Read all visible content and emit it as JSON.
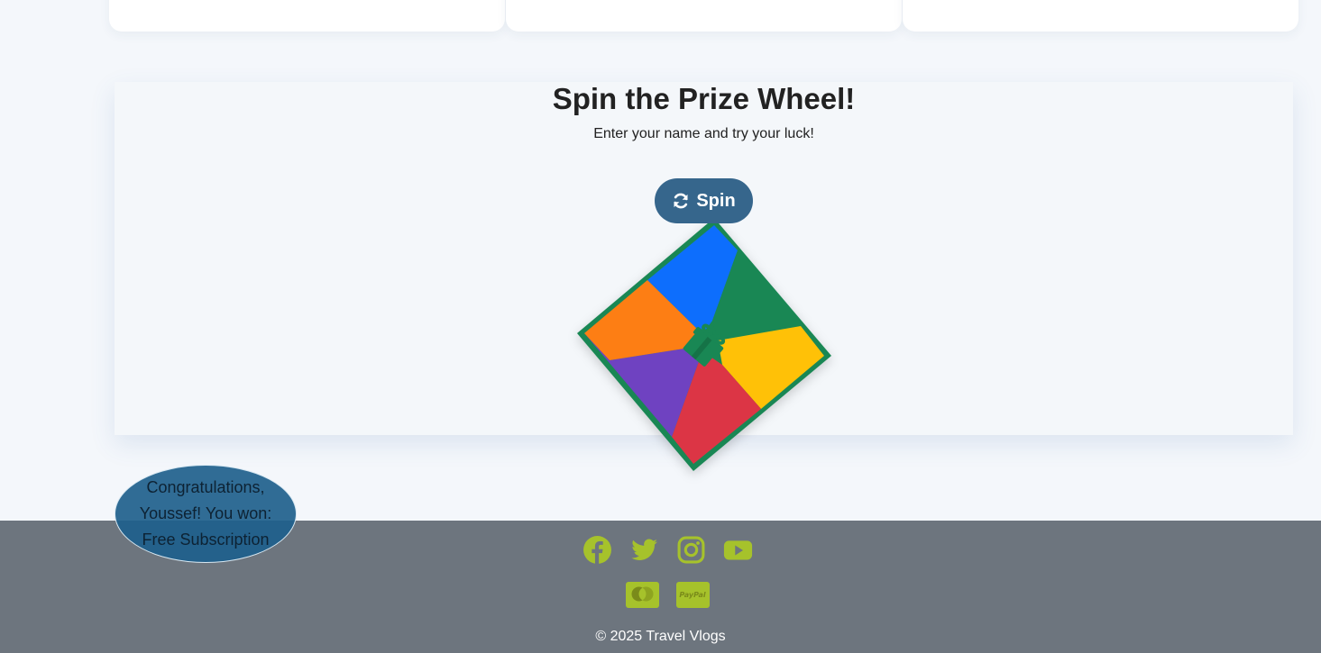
{
  "wheel": {
    "title": "Spin the Prize Wheel!",
    "subtitle": "Enter your name and try your luck!",
    "spin_label": "Spin",
    "segment_colors": [
      "#0d6efd",
      "#198754",
      "#ffc107",
      "#dc3545",
      "#6f42c1",
      "#fd7e14"
    ],
    "border_color": "#198754",
    "center_icon": "gift-icon"
  },
  "result": {
    "message": "Congratulations, Youssef! You won: Free Subscription"
  },
  "footer": {
    "social_icons": [
      "facebook-icon",
      "twitter-icon",
      "instagram-icon",
      "youtube-icon"
    ],
    "payment_icons": [
      "mastercard-icon",
      "paypal-icon"
    ],
    "paypal_label": "PayPal",
    "copyright": "© 2025 Travel Vlogs",
    "accent": "#a6c22b"
  }
}
